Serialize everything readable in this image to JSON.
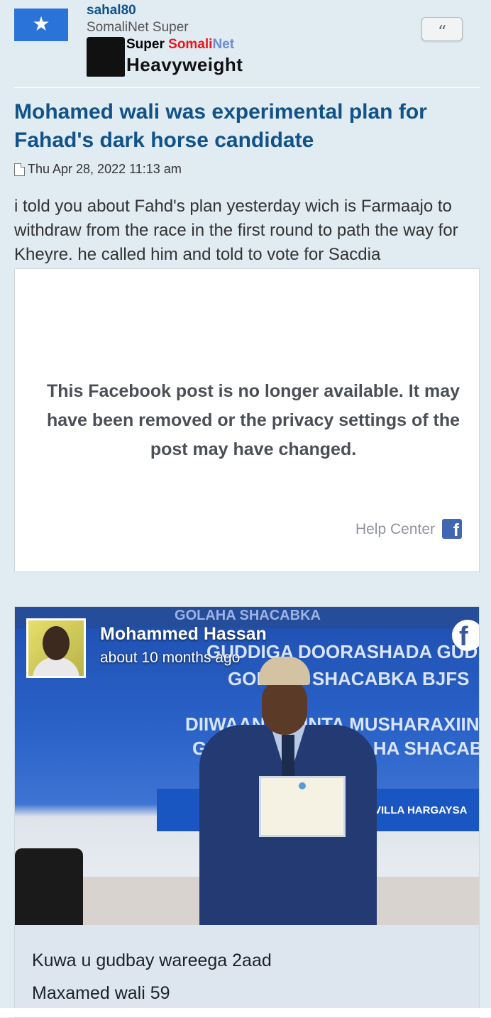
{
  "post": {
    "author": {
      "username": "sahal80",
      "rank": "SomaliNet Super",
      "rank_badge": {
        "word1": "Super",
        "word2": "Somali",
        "word3": "Net",
        "line2": "Heavyweight"
      }
    },
    "quote_button": "“",
    "title": "Mohamed wali was experimental plan for Fahad's dark horse candidate",
    "date": "Thu Apr 28, 2022 11:13 am",
    "body": "i told you about Fahd's plan yesterday wich is Farmaajo to withdraw from the race in the first round to path the way for Kheyre. he called him and told to vote for Sacdia"
  },
  "facebook_unavailable": {
    "message": "This Facebook post is no longer available. It may have been removed or the privacy settings of the post may have changed.",
    "help_link": "Help Center"
  },
  "facebook_embed": {
    "author": "Mohammed Hassan",
    "time": "about 10 months ago",
    "photo_text": {
      "top": "GOLAHA SHACABKA",
      "line1": "GUDDIGA DOORASHADA GUDDOONKA",
      "line2": "GOLAHA SHACABKA BJFS",
      "line3": "DIIWAANGELINTA MUSHARAXIINTA",
      "line4": "GUDDOONKA GOLAHA SHACABKA",
      "venue": "VILLA HARGAYSA"
    },
    "text_lines": [
      "Kuwa u gudbay wareega 2aad",
      "Maxamed wali 59"
    ]
  },
  "colors": {
    "background": "#e1ebf2",
    "title": "#105289",
    "facebook_blue": "#4267b2"
  }
}
